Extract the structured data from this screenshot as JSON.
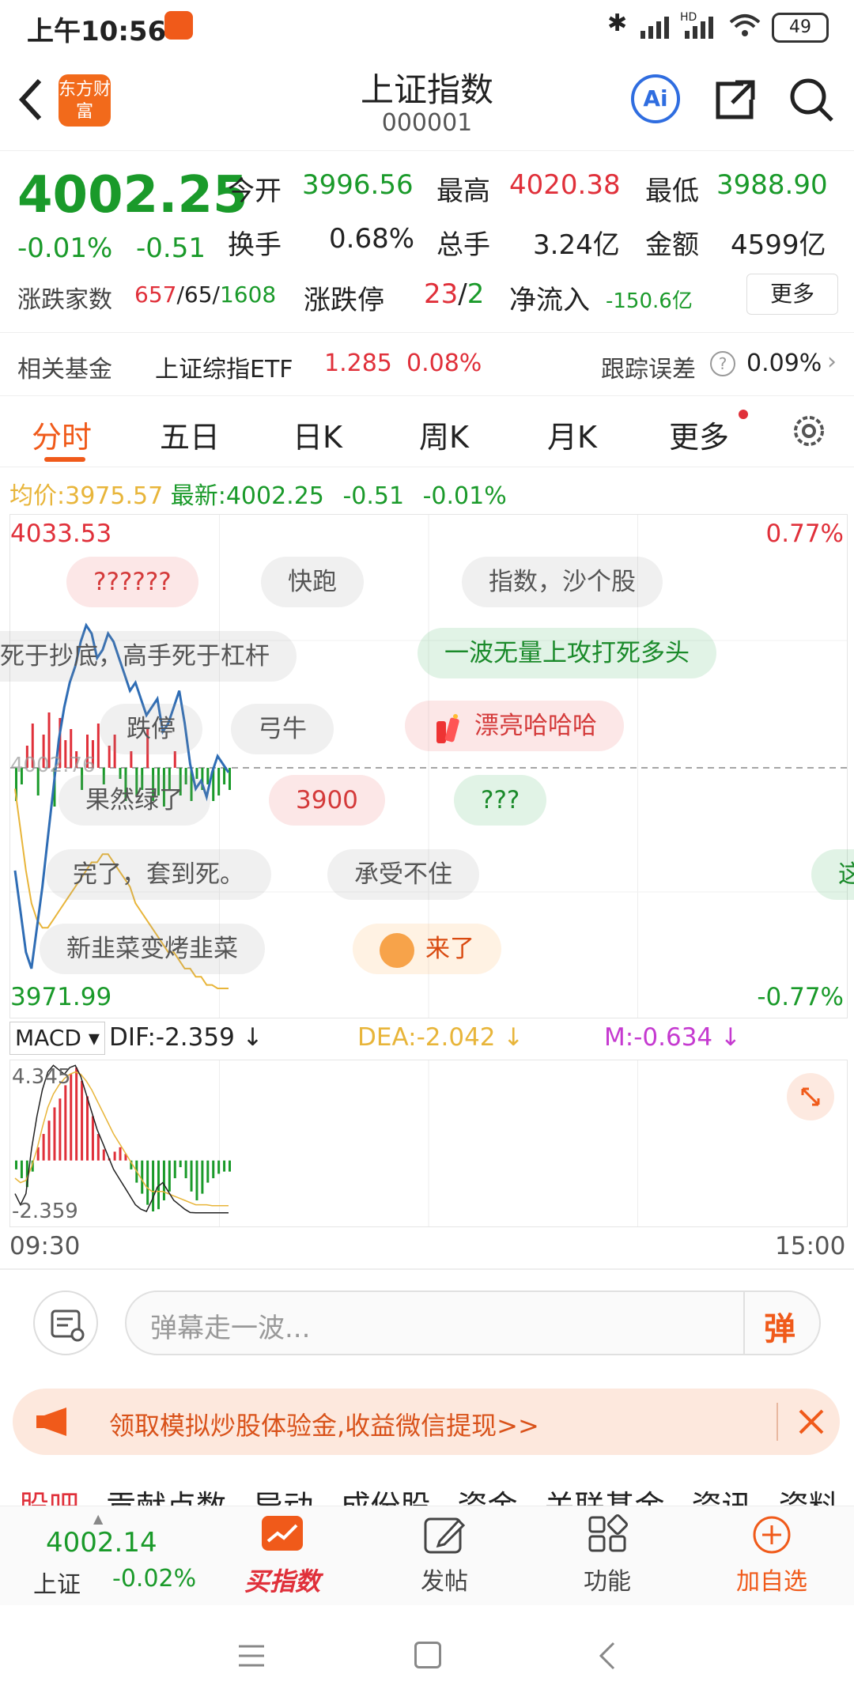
{
  "status": {
    "time": "上午10:56",
    "battery": "49",
    "signal_label": "HD"
  },
  "header": {
    "title": "上证指数",
    "code": "000001",
    "logo_text": "东方财富",
    "ai_label": "Ai"
  },
  "quote": {
    "price": "4002.25",
    "pct": "-0.01%",
    "chg": "-0.51",
    "open_label": "今开",
    "open": "3996.56",
    "high_label": "最高",
    "high": "4020.38",
    "low_label": "最低",
    "low": "3988.90",
    "turnover_label": "换手",
    "turnover": "0.68%",
    "volume_label": "总手",
    "volume": "3.24亿",
    "amount_label": "金额",
    "amount": "4599亿",
    "breadth_label": "涨跌家数",
    "up": "657",
    "flat": "65",
    "down": "1608",
    "sep": "/",
    "limit_label": "涨跌停",
    "limit_up": "23",
    "limit_down": "2",
    "netflow_label": "净流入",
    "netflow": "-150.6亿",
    "more": "更多"
  },
  "fund": {
    "label": "相关基金",
    "name": "上证综指ETF",
    "price": "1.285",
    "pct": "0.08%",
    "error_label": "跟踪误差",
    "error": "0.09%"
  },
  "tabs": [
    "分时",
    "五日",
    "日K",
    "周K",
    "月K",
    "更多"
  ],
  "chart_info": {
    "avg_label": "均价:",
    "avg": "3975.57",
    "latest_label": "最新:",
    "latest": "4002.25",
    "chg": "-0.51",
    "pct": "-0.01%"
  },
  "chart_data": {
    "type": "line",
    "y_top_label": "4033.53",
    "y_top_pct": "0.77%",
    "y_bottom_label": "3971.99",
    "y_bottom_pct": "-0.77%",
    "prev_close": "4002.76",
    "ylim": [
      3971.99,
      4033.53
    ],
    "x_start": "09:30",
    "x_end": "15:00",
    "price_series": [
      3990,
      3985,
      3980,
      3978,
      3983,
      3988,
      3994,
      4000,
      4006,
      4010,
      4013,
      4015,
      4018,
      4020,
      4019,
      4016,
      4017,
      4019,
      4018,
      4016,
      4014,
      4012,
      4013,
      4011,
      4009,
      4010,
      4011,
      4007,
      4008,
      4010,
      4012,
      4008,
      4003,
      4000,
      4001,
      3999,
      4002,
      4004,
      4003,
      4002
    ],
    "avg_series": [
      4000,
      3995,
      3990,
      3986,
      3984,
      3983,
      3983,
      3984,
      3985,
      3986,
      3987,
      3988,
      3989,
      3990,
      3991,
      3991,
      3992,
      3992,
      3991,
      3990,
      3989,
      3988,
      3986,
      3985,
      3984,
      3983,
      3982,
      3981,
      3980,
      3980,
      3979,
      3978,
      3978,
      3977,
      3977,
      3976,
      3976,
      3975.57,
      3975.57,
      3975.57
    ],
    "volume_bars": [
      -0.6,
      -0.3,
      0.4,
      0.8,
      -0.5,
      0.6,
      1.0,
      -0.7,
      0.9,
      0.5,
      0.7,
      0.3,
      -0.4,
      0.6,
      0.5,
      0.8,
      -0.3,
      0.4,
      0.6,
      -0.2,
      -0.6,
      0.3,
      -0.5,
      -0.4,
      0.7,
      -0.6,
      -0.5,
      -0.7,
      -0.4,
      0.3,
      -0.5,
      -0.3,
      -0.6,
      -0.2,
      -0.4,
      -0.3,
      -0.6,
      -0.5,
      -0.3,
      -0.4
    ],
    "macd": {
      "label": "MACD",
      "dif_label": "DIF:",
      "dif": "-2.359",
      "dea_label": "DEA:",
      "dea": "-2.042",
      "m_label": "M:",
      "m": "-0.634",
      "ymax_label": "4.345",
      "ymin_label": "-2.359",
      "bars": [
        -0.4,
        -0.8,
        -1.2,
        -0.5,
        0.6,
        1.2,
        1.8,
        2.4,
        2.8,
        3.4,
        3.9,
        4.2,
        3.6,
        2.9,
        2.0,
        1.2,
        0.5,
        0.1,
        0.4,
        0.6,
        0.3,
        -0.4,
        -1.0,
        -1.5,
        -2.0,
        -2.3,
        -2.2,
        -1.8,
        -1.4,
        -0.8,
        -0.3,
        -0.8,
        -1.4,
        -1.8,
        -1.5,
        -1.0,
        -0.8,
        -0.6,
        -0.5,
        -0.5
      ],
      "dif_series": [
        -1.5,
        -2.0,
        -1.5,
        0.5,
        2.0,
        3.2,
        4.0,
        4.3,
        4.1,
        3.9,
        4.2,
        4.3,
        3.8,
        3.0,
        2.2,
        1.4,
        0.8,
        0.2,
        -0.4,
        -0.8,
        -1.2,
        -1.6,
        -2.0,
        -2.2,
        -2.3,
        -1.8,
        -1.2,
        -1.0,
        -1.4,
        -1.8,
        -2.0,
        -2.2,
        -2.35,
        -2.36,
        -2.36,
        -2.36,
        -2.36,
        -2.36,
        -2.359,
        -2.359
      ],
      "dea_series": [
        -0.8,
        -1.0,
        -0.9,
        -0.3,
        0.5,
        1.5,
        2.4,
        3.0,
        3.4,
        3.7,
        3.9,
        4.0,
        3.9,
        3.6,
        3.2,
        2.7,
        2.2,
        1.7,
        1.2,
        0.8,
        0.4,
        0.0,
        -0.4,
        -0.8,
        -1.2,
        -1.4,
        -1.4,
        -1.4,
        -1.5,
        -1.6,
        -1.7,
        -1.8,
        -1.9,
        -2.0,
        -2.0,
        -2.0,
        -2.04,
        -2.04,
        -2.042,
        -2.042
      ]
    }
  },
  "danmaku": [
    {
      "text": "??????",
      "style": "dm-red"
    },
    {
      "text": "快跑",
      "style": "dm-gray"
    },
    {
      "text": "指数，沙个股",
      "style": "dm-gray"
    },
    {
      "text": "死于抄底，高手死于杠杆",
      "style": "dm-gray"
    },
    {
      "text": "一波无量上攻打死多头",
      "style": "dm-green"
    },
    {
      "text": "跌停",
      "style": "dm-gray"
    },
    {
      "text": "弓牛",
      "style": "dm-gray"
    },
    {
      "text": "漂亮哈哈哈",
      "style": "dm-red"
    },
    {
      "text": "果然绿了",
      "style": "dm-gray"
    },
    {
      "text": "3900",
      "style": "dm-red"
    },
    {
      "text": "???",
      "style": "dm-green"
    },
    {
      "text": "完了，套到死。",
      "style": "dm-gray"
    },
    {
      "text": "承受不住",
      "style": "dm-gray"
    },
    {
      "text": "这",
      "style": "dm-green"
    },
    {
      "text": "新韭菜变烤韭菜",
      "style": "dm-gray"
    },
    {
      "text": "来了",
      "style": "dm-orange"
    }
  ],
  "comment": {
    "placeholder": "弹幕走一波...",
    "send": "弹"
  },
  "promo": {
    "text": "领取模拟炒股体验金,收益微信提现>>"
  },
  "subtabs": [
    "股吧",
    "贡献点数",
    "异动",
    "成份股",
    "资金",
    "关联基金",
    "资讯",
    "资料"
  ],
  "bottom": {
    "price": "4002.14",
    "name": "上证",
    "pct": "-0.02%",
    "buy": "买指数",
    "post": "发帖",
    "func": "功能",
    "add": "加自选"
  },
  "colors": {
    "red": "#e0303a",
    "green": "#1a9a2a",
    "accent": "#f05a1a",
    "avg_line": "#e8b53a",
    "price_line": "#2f6db5"
  }
}
